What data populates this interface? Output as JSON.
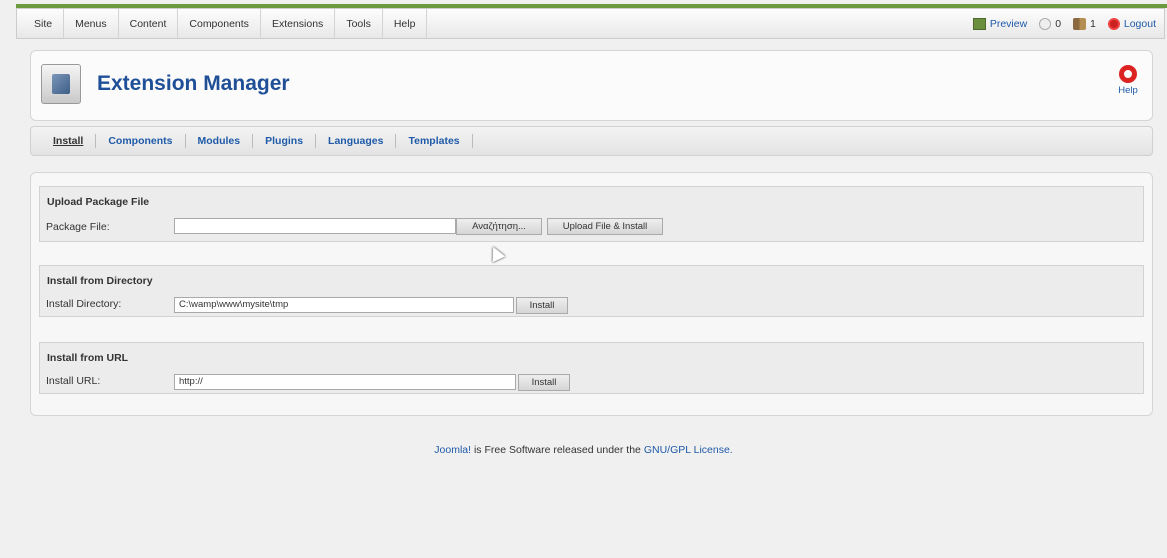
{
  "menubar": {
    "items": [
      "Site",
      "Menus",
      "Content",
      "Components",
      "Extensions",
      "Tools",
      "Help"
    ],
    "status": {
      "preview": "Preview",
      "messages_count": "0",
      "users_count": "1",
      "logout": "Logout"
    }
  },
  "header": {
    "title": "Extension Manager",
    "help_label": "Help"
  },
  "subnav": {
    "items": [
      "Install",
      "Components",
      "Modules",
      "Plugins",
      "Languages",
      "Templates"
    ],
    "active_index": 0
  },
  "upload": {
    "title": "Upload Package File",
    "label": "Package File:",
    "value": "",
    "browse_label": "Αναζήτηση...",
    "submit_label": "Upload File & Install"
  },
  "directory": {
    "title": "Install from Directory",
    "label": "Install Directory:",
    "value": "C:\\wamp\\www\\mysite\\tmp",
    "submit_label": "Install"
  },
  "url": {
    "title": "Install from URL",
    "label": "Install URL:",
    "value": "http://",
    "submit_label": "Install"
  },
  "footer": {
    "brand": "Joomla!",
    "middle": " is Free Software released under the ",
    "license": "GNU/GPL License."
  },
  "colors": {
    "accent_green": "#6c9a3f",
    "title_blue": "#1f4f96",
    "link_blue": "#1f5aa8"
  }
}
